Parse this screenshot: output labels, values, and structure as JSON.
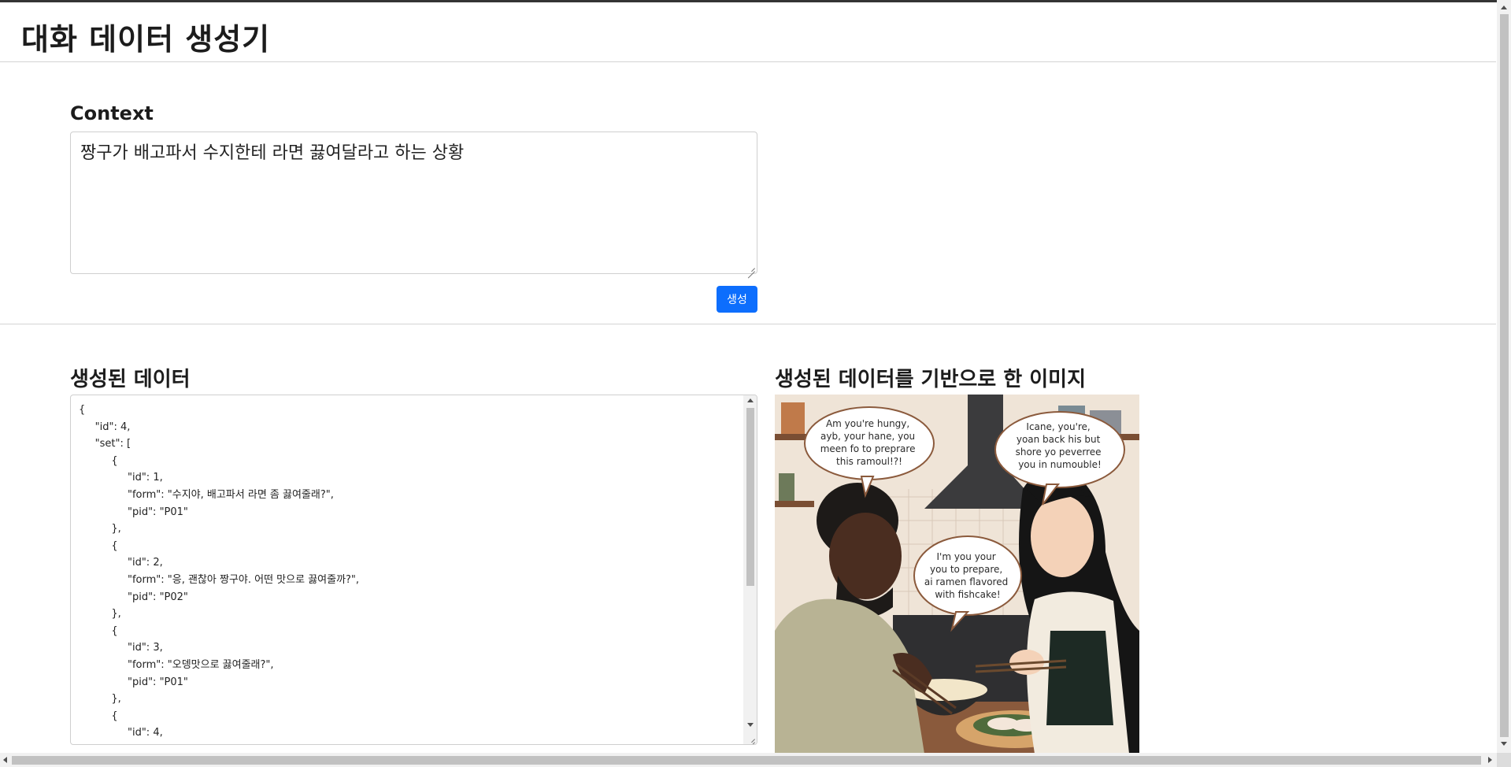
{
  "header": {
    "title": "대화 데이터 생성기"
  },
  "context": {
    "label": "Context",
    "value": "짱구가 배고파서 수지한테 라면 끓여달라고 하는 상황"
  },
  "generate_button": {
    "label": "생성"
  },
  "output": {
    "label": "생성된 데이터",
    "json_text": "{\n     \"id\": 4,\n     \"set\": [\n          {\n               \"id\": 1,\n               \"form\": \"수지야, 배고파서 라면 좀 끓여줄래?\",\n               \"pid\": \"P01\"\n          },\n          {\n               \"id\": 2,\n               \"form\": \"응, 괜찮아 짱구야. 어떤 맛으로 끓여줄까?\",\n               \"pid\": \"P02\"\n          },\n          {\n               \"id\": 3,\n               \"form\": \"오뎅맛으로 끓여줄래?\",\n               \"pid\": \"P01\"\n          },\n          {\n               \"id\": 4,"
  },
  "image_section": {
    "label": "생성된 데이터를 기반으로 한 이미지",
    "bubbles": [
      {
        "lines": [
          "Am you're hungy,",
          "ayb, your hane, you",
          "meen fo to preprare",
          "this ramoul!?!"
        ]
      },
      {
        "lines": [
          "Icane, you're,",
          "yoan back his but",
          "shore yo peverree",
          "you in numouble!"
        ]
      },
      {
        "lines": [
          "I'm you your",
          "you to prepare,",
          "ai ramen flavored",
          "with fishcake!"
        ]
      }
    ]
  },
  "colors": {
    "primary_button": "#0d6efd",
    "wall": "#f1e7db",
    "wood": "#8a5a3c"
  }
}
